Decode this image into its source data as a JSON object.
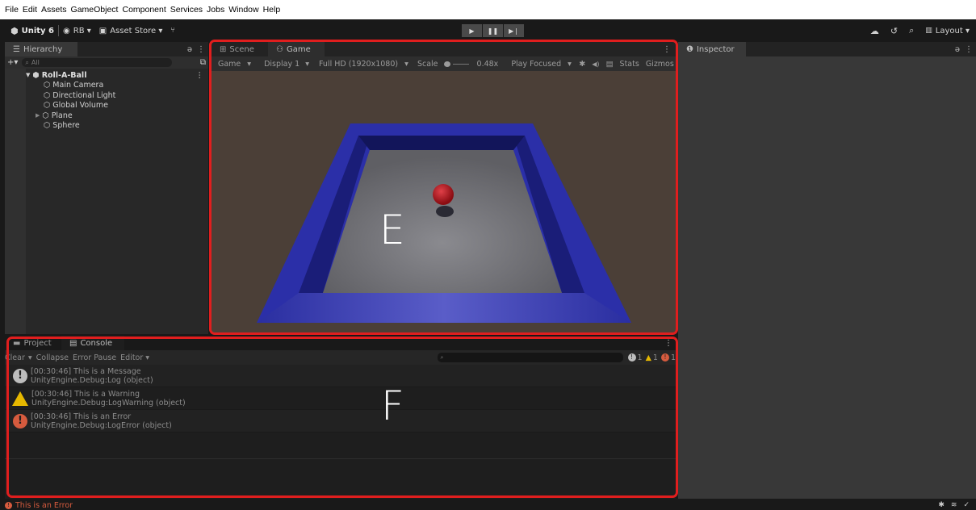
{
  "menu": [
    "File",
    "Edit",
    "Assets",
    "GameObject",
    "Component",
    "Services",
    "Jobs",
    "Window",
    "Help"
  ],
  "toolbar": {
    "unity_label": "Unity 6",
    "account_label": "RB ▾",
    "asset_store_label": "Asset Store ▾",
    "layout_label": "Layout ▾"
  },
  "hierarchy": {
    "tab": "Hierarchy",
    "search_placeholder": "All",
    "scene": "Roll-A-Ball",
    "items": [
      "Main Camera",
      "Directional Light",
      "Global Volume",
      "Plane",
      "Sphere"
    ]
  },
  "game": {
    "tab_scene": "Scene",
    "tab_game": "Game",
    "mode": "Game",
    "display": "Display 1",
    "resolution": "Full HD (1920x1080)",
    "scale_label": "Scale",
    "scale_value": "0.48x",
    "play_focused": "Play Focused",
    "stats": "Stats",
    "gizmos": "Gizmos",
    "overlay_letter": "E"
  },
  "inspector": {
    "tab": "Inspector"
  },
  "bottom": {
    "tab_project": "Project",
    "tab_console": "Console",
    "clear": "Clear",
    "collapse": "Collapse",
    "error_pause": "Error Pause",
    "editor": "Editor ▾",
    "count_messages": "1",
    "count_warnings": "1",
    "count_errors": "1",
    "overlay_letter": "F",
    "logs": [
      {
        "time_text": "[00:30:46] This is a Message",
        "detail": "UnityEngine.Debug:Log (object)",
        "level": "message"
      },
      {
        "time_text": "[00:30:46] This is a Warning",
        "detail": "UnityEngine.Debug:LogWarning (object)",
        "level": "warning"
      },
      {
        "time_text": "[00:30:46] This is an Error",
        "detail": "UnityEngine.Debug:LogError (object)",
        "level": "error"
      }
    ]
  },
  "status": {
    "text": "This is an Error"
  },
  "colors": {
    "highlight_box": "#e01e1e",
    "error": "#d65b3e",
    "warning": "#e6b800",
    "arena_wall": "#2b2fa8",
    "ball": "#b0141a"
  }
}
